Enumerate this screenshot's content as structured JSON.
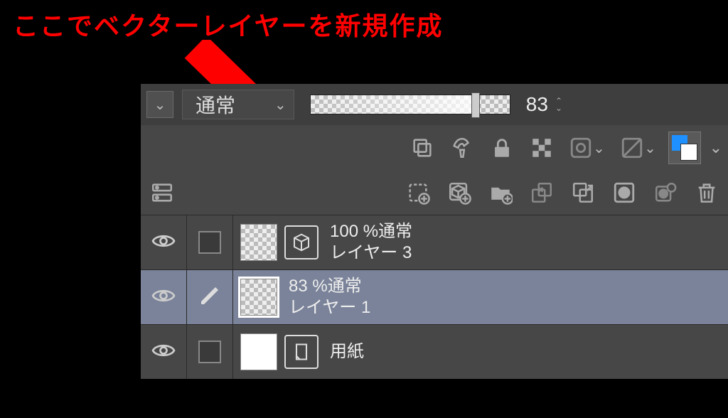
{
  "annotation": {
    "text": "ここでベクターレイヤーを新規作成"
  },
  "panel": {
    "blend_mode": "通常",
    "opacity_value": "83",
    "icons": {
      "clip": "clip",
      "mask": "mask",
      "lock": "lock",
      "lock_alpha": "lock-alpha",
      "ref": "ref",
      "draft": "draft"
    },
    "row3": {
      "view": "view-toggle",
      "new_raster": "new-raster-layer",
      "new_vector": "new-vector-layer",
      "new_folder": "new-folder",
      "transfer": "transfer-layer",
      "merge": "merge-layer",
      "mask_btn": "layer-mask",
      "apply_mask": "enable-mask",
      "trash": "delete-layer"
    }
  },
  "layers": [
    {
      "opacity": "100 %",
      "blend": "通常",
      "name": "レイヤー 3",
      "type": "vector",
      "selected": false,
      "editing": false
    },
    {
      "opacity": "83 %",
      "blend": "通常",
      "name": "レイヤー 1",
      "type": "raster",
      "selected": true,
      "editing": true
    },
    {
      "opacity": "",
      "blend": "",
      "name": "用紙",
      "type": "paper",
      "selected": false,
      "editing": false
    }
  ]
}
